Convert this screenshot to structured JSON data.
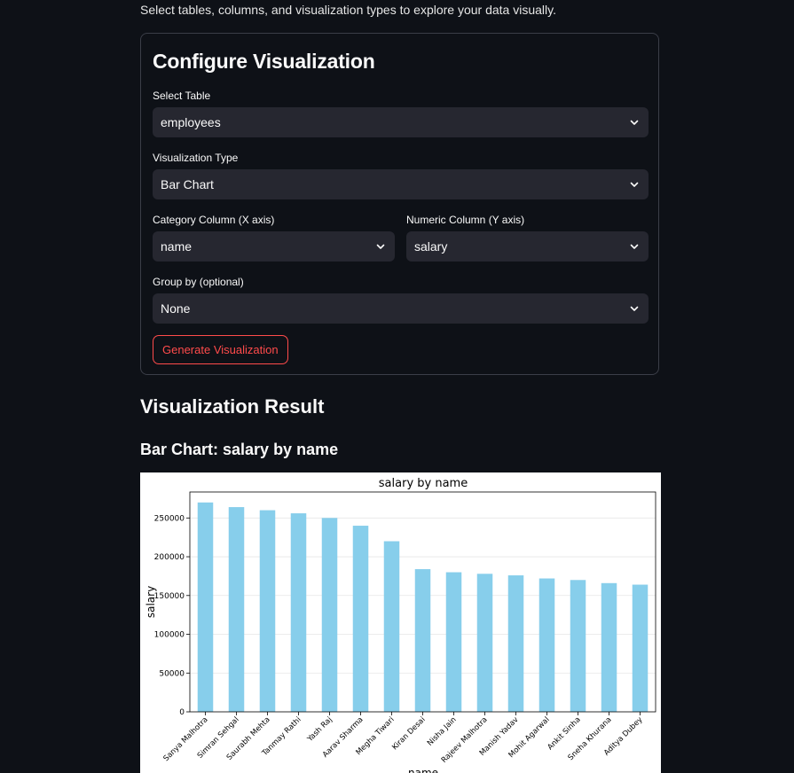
{
  "page": {
    "intro": "Select tables, columns, and visualization types to explore your data visually."
  },
  "config": {
    "title": "Configure Visualization",
    "table": {
      "label": "Select Table",
      "value": "employees"
    },
    "viz_type": {
      "label": "Visualization Type",
      "value": "Bar Chart"
    },
    "category_column": {
      "label": "Category Column (X axis)",
      "value": "name"
    },
    "numeric_column": {
      "label": "Numeric Column (Y axis)",
      "value": "salary"
    },
    "group_by": {
      "label": "Group by (optional)",
      "value": "None"
    },
    "generate_label": "Generate Visualization"
  },
  "result": {
    "title": "Visualization Result",
    "chart_heading": "Bar Chart: salary by name"
  },
  "colors": {
    "background": "#0e1117",
    "select_bg": "#262730",
    "accent": "#ff4b4b",
    "bar": "#87ceeb"
  },
  "icons": {
    "select_chevron": "chevron-down-icon"
  },
  "chart_data": {
    "type": "bar",
    "title": "salary by name",
    "xlabel": "name",
    "ylabel": "salary",
    "categories": [
      "Sanya Malhotra",
      "Simran Sehgal",
      "Saurabh Mehta",
      "Tanmay Rathi",
      "Yash Raj",
      "Aarav Sharma",
      "Megha Tiwari",
      "Kiran Desai",
      "Nisha Jain",
      "Rajeev Malhotra",
      "Manish Yadav",
      "Mohit Agarwal",
      "Ankit Sinha",
      "Sneha Khurana",
      "Aditya Dubey"
    ],
    "values": [
      270000,
      264000,
      260000,
      256000,
      250000,
      240000,
      220000,
      184000,
      180000,
      178000,
      176000,
      172000,
      170000,
      166000,
      164000
    ],
    "ylim": [
      0,
      283500
    ],
    "yticks": [
      0,
      50000,
      100000,
      150000,
      200000,
      250000
    ],
    "ytick_labels": [
      "0",
      "50000",
      "100000",
      "150000",
      "200000",
      "250000"
    ],
    "grid": "horizontal",
    "legend": "none"
  }
}
